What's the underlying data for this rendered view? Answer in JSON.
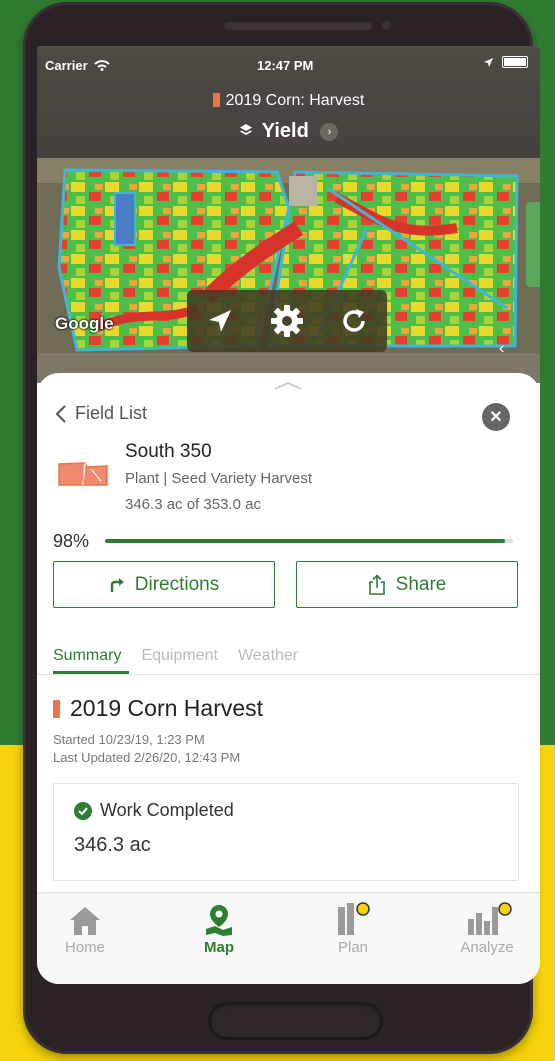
{
  "status_bar": {
    "carrier": "Carrier",
    "time": "12:47 PM"
  },
  "header": {
    "operation": "2019 Corn: Harvest",
    "layer": "Yield"
  },
  "map": {
    "attribution": "Google"
  },
  "sheet": {
    "back_label": "Field List",
    "field": {
      "name": "South 350",
      "subtitle": "Plant | Seed Variety Harvest",
      "area": "346.3 ac of 353.0 ac"
    },
    "progress": {
      "label": "98%",
      "fraction": 0.98
    },
    "directions_label": "Directions",
    "share_label": "Share",
    "tabs": [
      {
        "label": "Summary",
        "active": true
      },
      {
        "label": "Equipment",
        "active": false
      },
      {
        "label": "Weather",
        "active": false
      }
    ],
    "harvest": {
      "title": "2019 Corn Harvest",
      "started": "Started 10/23/19, 1:23 PM",
      "updated": "Last Updated 2/26/20, 12:43 PM"
    },
    "work": {
      "label": "Work Completed",
      "value": "346.3 ac"
    }
  },
  "tabbar": {
    "items": [
      {
        "label": "Home",
        "icon": "home-icon",
        "active": false
      },
      {
        "label": "Map",
        "icon": "map-pin-icon",
        "active": true
      },
      {
        "label": "Plan",
        "icon": "plan-icon",
        "active": false
      },
      {
        "label": "Analyze",
        "icon": "analyze-icon",
        "active": false
      }
    ]
  },
  "colors": {
    "brand_green": "#2f7d32",
    "brand_yellow": "#f5d20a",
    "operation_marker": "#e9734a"
  }
}
